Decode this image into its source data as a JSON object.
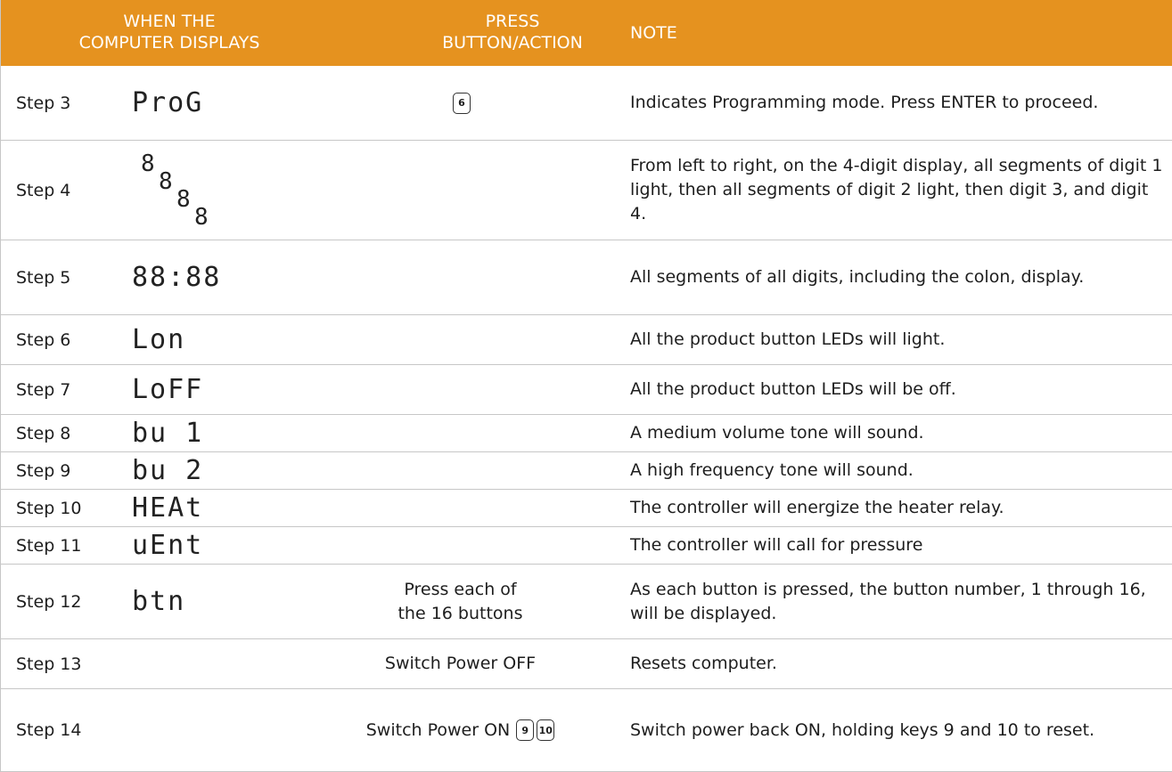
{
  "header": {
    "col1": "WHEN THE COMPUTER DISPLAYS",
    "col1_line1": "WHEN THE",
    "col1_line2": "COMPUTER DISPLAYS",
    "col2_line1": "PRESS",
    "col2_line2": "BUTTON/ACTION",
    "col3": "NOTE"
  },
  "colors": {
    "header_bg": "#e5921f",
    "header_text": "#ffffff",
    "rule": "#c7c7c7"
  },
  "rows": [
    {
      "step": "Step 3",
      "display": "ProG",
      "keys": [
        "6"
      ],
      "action": "",
      "note": "Indicates Programming mode. Press ENTER to proceed."
    },
    {
      "step": "Step 4",
      "display_cascade": [
        "8",
        "8",
        "8",
        "8"
      ],
      "action": "",
      "note": "From left to right, on the 4-digit display, all segments of digit 1 light, then all segments of digit 2 light, then digit 3, and digit 4."
    },
    {
      "step": "Step 5",
      "display": "88:88",
      "action": "",
      "note": "All segments of all digits, including the colon, display."
    },
    {
      "step": "Step 6",
      "display": "Lon",
      "action": "",
      "note": "All the product button LEDs will light."
    },
    {
      "step": "Step 7",
      "display": "LoFF",
      "action": "",
      "note": "All the product button LEDs will be off."
    },
    {
      "step": "Step 8",
      "display": "bu 1",
      "action": "",
      "note": "A medium volume tone will sound."
    },
    {
      "step": "Step 9",
      "display": "bu 2",
      "action": "",
      "note": "A high frequency tone will sound."
    },
    {
      "step": "Step 10",
      "display": "HEAt",
      "action": "",
      "note": "The controller will energize the heater relay."
    },
    {
      "step": "Step 11",
      "display": "uEnt",
      "action": "",
      "note": "The controller will call for pressure"
    },
    {
      "step": "Step 12",
      "display": "btn",
      "action_line1": "Press each of",
      "action_line2": "the 16 buttons",
      "note": "As each button is pressed, the button number, 1 through 16, will be displayed."
    },
    {
      "step": "Step 13",
      "display": "",
      "action": "Switch Power OFF",
      "note": "Resets computer."
    },
    {
      "step": "Step 14",
      "display": "",
      "action": "Switch Power ON",
      "keys": [
        "9",
        "10"
      ],
      "note": "Switch power back ON, holding keys 9 and 10 to reset."
    }
  ]
}
